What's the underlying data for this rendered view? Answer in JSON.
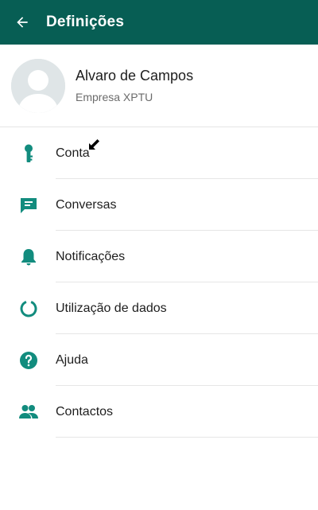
{
  "appbar": {
    "title": "Definições",
    "back_icon": "arrow-left-icon",
    "color": "#075e54"
  },
  "profile": {
    "name": "Alvaro de Campos",
    "status": "Empresa XPTU",
    "avatar_icon": "default-avatar-icon"
  },
  "accent_color": "#128c7e",
  "menu": {
    "items": [
      {
        "label": "Conta",
        "icon": "key-icon"
      },
      {
        "label": "Conversas",
        "icon": "chat-icon"
      },
      {
        "label": "Notificações",
        "icon": "bell-icon"
      },
      {
        "label": "Utilização de dados",
        "icon": "data-usage-icon"
      },
      {
        "label": "Ajuda",
        "icon": "help-icon"
      },
      {
        "label": "Contactos",
        "icon": "contacts-icon"
      }
    ]
  }
}
